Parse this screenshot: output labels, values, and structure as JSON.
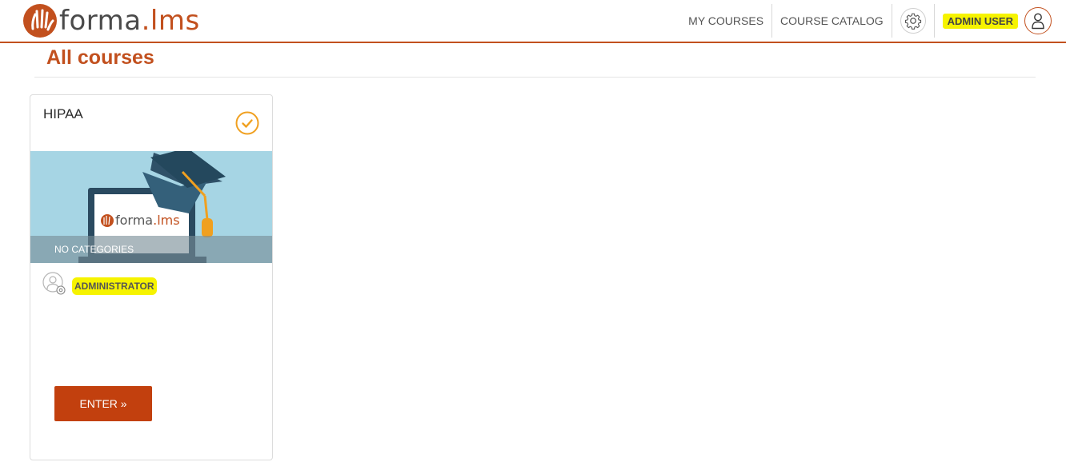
{
  "app": {
    "logo_text_main": "forma",
    "logo_text_sep": ".",
    "logo_text_accent": "lms"
  },
  "nav": {
    "my_courses": "MY COURSES",
    "course_catalog": "COURSE CATALOG",
    "settings_icon": "gear-icon",
    "user_name": "ADMIN USER",
    "user_icon": "user-icon"
  },
  "page": {
    "title": "All courses"
  },
  "courses": [
    {
      "title": "HIPAA",
      "status_icon": "check-circle-icon",
      "image_logo_main": "forma",
      "image_logo_sep": ".",
      "image_logo_accent": "lms",
      "category": "NO CATEGORIES",
      "role": "ADMINISTRATOR",
      "enter_label": "ENTER »"
    }
  ],
  "colors": {
    "brand": "#c2501e",
    "button": "#c2400e",
    "highlight": "#f6f300",
    "status_check": "#f0a020"
  }
}
